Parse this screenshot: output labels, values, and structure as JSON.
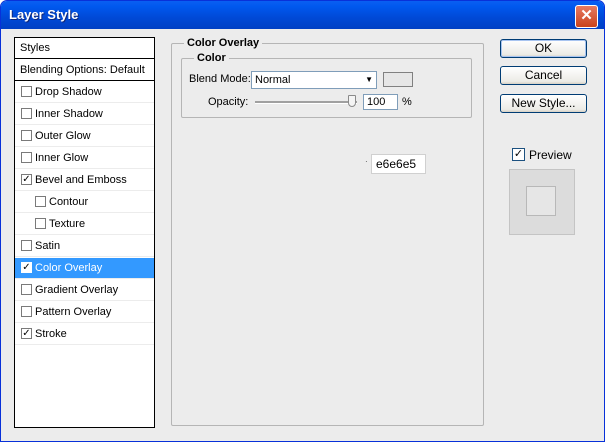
{
  "window": {
    "title": "Layer Style",
    "close_glyph": "✕"
  },
  "styles_list": {
    "header": "Styles",
    "blending_options": "Blending Options: Default",
    "items": [
      {
        "label": "Drop Shadow",
        "checked": false,
        "indent": false,
        "selected": false
      },
      {
        "label": "Inner Shadow",
        "checked": false,
        "indent": false,
        "selected": false
      },
      {
        "label": "Outer Glow",
        "checked": false,
        "indent": false,
        "selected": false
      },
      {
        "label": "Inner Glow",
        "checked": false,
        "indent": false,
        "selected": false
      },
      {
        "label": "Bevel and Emboss",
        "checked": true,
        "indent": false,
        "selected": false
      },
      {
        "label": "Contour",
        "checked": false,
        "indent": true,
        "selected": false
      },
      {
        "label": "Texture",
        "checked": false,
        "indent": true,
        "selected": false
      },
      {
        "label": "Satin",
        "checked": false,
        "indent": false,
        "selected": false
      },
      {
        "label": "Color Overlay",
        "checked": true,
        "indent": false,
        "selected": true
      },
      {
        "label": "Gradient Overlay",
        "checked": false,
        "indent": false,
        "selected": false
      },
      {
        "label": "Pattern Overlay",
        "checked": false,
        "indent": false,
        "selected": false
      },
      {
        "label": "Stroke",
        "checked": true,
        "indent": false,
        "selected": false
      }
    ]
  },
  "color_overlay": {
    "group_title": "Color Overlay",
    "color_group_title": "Color",
    "blend_mode_label": "Blend Mode:",
    "blend_mode_value": "Normal",
    "swatch_color": "#e6e6e6",
    "opacity_label": "Opacity:",
    "opacity_value": "100",
    "opacity_percent": 100,
    "percent_sign": "%",
    "hex_tooltip": "e6e6e5"
  },
  "buttons": {
    "ok": "OK",
    "cancel": "Cancel",
    "new_style": "New Style..."
  },
  "preview": {
    "label": "Preview",
    "checked": true
  },
  "colors": {
    "selection": "#3399ff",
    "titlebar": "#0058ee"
  }
}
